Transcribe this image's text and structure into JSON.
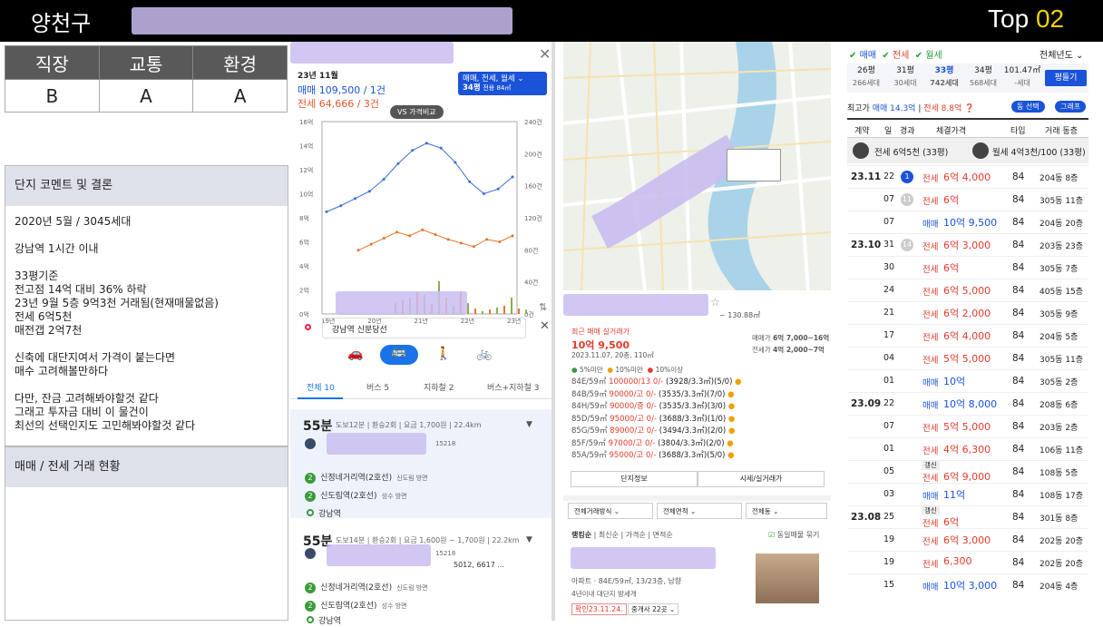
{
  "header": {
    "region": "양천구",
    "top_label": "Top",
    "top_number": "02"
  },
  "grades": {
    "headers": [
      "직장",
      "교통",
      "환경"
    ],
    "values": [
      "B",
      "A",
      "A"
    ]
  },
  "comment": {
    "title": "단지 코멘트 및 결론",
    "body": "2020년 5월 / 3045세대\n\n강남역 1시간 이내\n\n33평기준\n전고점 14억 대비 36% 하락\n23년 9월 5층 9억3천 거래됨(현재매물없음)\n전세 6억5천\n매전갭 2억7천\n\n신축에 대단지여서 가격이 붙는다면\n매수 고려해볼만하다\n\n다만, 잔금 고려해봐야할것 같다\n그래고 투자금 대비 이 물건이\n최선의 선택인지도 고민해봐야할것 같다"
  },
  "trade_status": {
    "title": "매매 / 전세 거래 현황"
  },
  "price_chart": {
    "date": "23년 11월",
    "sale": "매매 109,500 / 1건",
    "jeonse": "전세 64,666 / 3건",
    "filter": "매매, 전세, 월세",
    "size": "34평",
    "size_sub": "전용 84㎡",
    "compare_btn": "VS 가격비교"
  },
  "chart_data": {
    "type": "line",
    "x": [
      "19년",
      "20년",
      "21년",
      "22년",
      "23년"
    ],
    "y_left_ticks": [
      "16억",
      "14억",
      "12억",
      "10억",
      "8억",
      "6억",
      "4억",
      "2억",
      "0억"
    ],
    "y_right_ticks": [
      "240건",
      "200건",
      "160건",
      "120건",
      "80건",
      "40건",
      "0건"
    ],
    "series": [
      {
        "name": "매매",
        "values": [
          8.5,
          9.0,
          9.6,
          10.2,
          11.2,
          12.5,
          13.6,
          14.2,
          13.8,
          12.6,
          11.0,
          10.0,
          10.4,
          11.4
        ]
      },
      {
        "name": "전세",
        "values": [
          5.3,
          5.8,
          6.3,
          6.8,
          6.5,
          7.0,
          6.6,
          6.2,
          5.9,
          5.6,
          6.2,
          6.0,
          6.5
        ]
      }
    ],
    "volume": [
      20,
      25,
      30,
      40,
      35,
      18,
      60,
      30,
      15,
      40,
      20,
      10,
      5,
      8,
      12,
      15,
      30,
      10,
      8
    ]
  },
  "route": {
    "dest": "강남역 신분당선",
    "tabs": [
      "전체 10",
      "버스 5",
      "지하철 2",
      "버스+지하철 3"
    ],
    "r1": {
      "time": "55분",
      "detail": "도보12분 | 환승2회 | 요금 1,700원 | 22.4km",
      "code": "15218",
      "stops": [
        "신정네거리역(2호선)",
        "신도림역(2호선)",
        "강남역"
      ],
      "dirs": [
        "신도림 방면",
        "성수 방면"
      ]
    },
    "r2": {
      "time": "55분",
      "detail": "도보14분 | 환승2회 | 요금 1,600원 ~ 1,700원 | 22.2km",
      "code": "15218",
      "bus": "5012, 6617 ...",
      "stops": [
        "신정네거리역(2호선)",
        "신도림역(2호선)",
        "강남역"
      ],
      "dirs": [
        "신도림 방면",
        "성수 방면"
      ]
    }
  },
  "listing": {
    "area": "~ 130.88㎡",
    "recent_label": "최근 매매 실거래가",
    "recent_price": "10억 9,500",
    "recent_date": "2023.11.07, 20층, 110㎡",
    "sale_range_label": "매매가",
    "sale_range": "6억 7,000~16억",
    "jeonse_range_label": "전세가",
    "jeonse_range": "4억 2,000~7억",
    "legend": [
      "5%미만",
      "10%미만",
      "10%이상"
    ],
    "rows": [
      {
        "type": "84E/59㎡",
        "price": "100000/13 0/-",
        "info": "(3928/3.3㎡)(5/0)"
      },
      {
        "type": "84B/59㎡",
        "price": "90000/고 0/-",
        "info": "(3535/3.3㎡)(7/0)"
      },
      {
        "type": "84H/59㎡",
        "price": "90000/중 0/-",
        "info": "(3535/3.3㎡)(3/0)"
      },
      {
        "type": "85D/59㎡",
        "price": "95000/고 0/-",
        "info": "(3688/3.3㎡)(1/0)"
      },
      {
        "type": "85G/59㎡",
        "price": "89000/고 0/-",
        "info": "(3494/3.3㎡)(2/0)"
      },
      {
        "type": "85F/59㎡",
        "price": "97000/고 0/-",
        "info": "(3804/3.3㎡)(2/0)"
      },
      {
        "type": "85A/59㎡",
        "price": "95000/고 0/-",
        "info": "(3688/3.3㎡)(5/0)"
      }
    ],
    "btn1": "단지정보",
    "btn2": "시세/실거래가",
    "selects": [
      "전체거래방식",
      "전체면적",
      "전체동"
    ],
    "sorts": [
      "랭킹순",
      "최신순",
      "가격순",
      "면적순"
    ],
    "same_label": "동일매물 묶기",
    "item_desc": "아파트 · 84E/59㎡, 13/23층, 남향",
    "item_tags": "4년이내  대단지  방세개",
    "item_confirm": "확인23.11.24.",
    "item_agent": "중개사 22곳"
  },
  "right": {
    "filters": [
      "매매",
      "전세",
      "월세"
    ],
    "year": "전체년도",
    "sizes": [
      {
        "p": "26평",
        "u": "266세대"
      },
      {
        "p": "31평",
        "u": "30세대"
      },
      {
        "p": "33평",
        "u": "742세대"
      },
      {
        "p": "34평",
        "u": "568세대"
      },
      {
        "p": "101.47㎡",
        "u": "-세대"
      }
    ],
    "size_btn": "평들기",
    "recent": "최고가",
    "recent_sale": "매매 14.3억",
    "recent_jeonse": "전세 8.8억",
    "btn_dong": "동 선택",
    "btn_graph": "그래프",
    "cols": [
      "계약",
      "일",
      "경과",
      "체결가격",
      "타입",
      "거래 동층"
    ],
    "pinned": [
      {
        "label": "전세 6억5천 (33평)"
      },
      {
        "label": "월세 4억3천/100 (33평)"
      }
    ],
    "rows": [
      {
        "m": "23.11",
        "d": "22",
        "k": "1",
        "kind": "전세",
        "p": "6억 4,000",
        "t": "84",
        "f": "204동  8층"
      },
      {
        "m": "",
        "d": "07",
        "k": "11",
        "kind": "전세",
        "p": "6억",
        "t": "84",
        "f": "305동 11층"
      },
      {
        "m": "",
        "d": "07",
        "k": "",
        "kind": "매매",
        "p": "10억 9,500",
        "t": "84",
        "f": "204동 20층"
      },
      {
        "m": "23.10",
        "d": "31",
        "k": "14",
        "kind": "전세",
        "p": "6억 3,000",
        "t": "84",
        "f": "203동 23층"
      },
      {
        "m": "",
        "d": "30",
        "k": "",
        "kind": "전세",
        "p": "6억",
        "t": "84",
        "f": "305동  7층"
      },
      {
        "m": "",
        "d": "24",
        "k": "",
        "kind": "전세",
        "p": "6억 5,000",
        "t": "84",
        "f": "405동 15층"
      },
      {
        "m": "",
        "d": "21",
        "k": "",
        "kind": "전세",
        "p": "6억 2,000",
        "t": "84",
        "f": "305동  9층"
      },
      {
        "m": "",
        "d": "17",
        "k": "",
        "kind": "전세",
        "p": "6억 4,000",
        "t": "84",
        "f": "204동  5층"
      },
      {
        "m": "",
        "d": "04",
        "k": "",
        "kind": "전세",
        "p": "5억 5,000",
        "t": "84",
        "f": "305동 11층"
      },
      {
        "m": "",
        "d": "01",
        "k": "",
        "kind": "매매",
        "p": "10억",
        "t": "84",
        "f": "305동  2층"
      },
      {
        "m": "23.09",
        "d": "22",
        "k": "",
        "kind": "매매",
        "p": "10억 8,000",
        "t": "84",
        "f": "208동  6층"
      },
      {
        "m": "",
        "d": "07",
        "k": "",
        "kind": "전세",
        "p": "5억 5,000",
        "t": "84",
        "f": "203동  2층"
      },
      {
        "m": "",
        "d": "01",
        "k": "",
        "kind": "전세",
        "p": "4억 6,300",
        "t": "84",
        "f": "106동 11층"
      },
      {
        "m": "",
        "d": "05",
        "k": "",
        "kind": "전세",
        "p": "6억 9,000",
        "t": "84",
        "f": "108동  5층",
        "tag": "갱신"
      },
      {
        "m": "",
        "d": "03",
        "k": "",
        "kind": "매매",
        "p": "11억",
        "t": "84",
        "f": "108동 17층"
      },
      {
        "m": "23.08",
        "d": "25",
        "k": "",
        "kind": "전세",
        "p": "6억",
        "t": "84",
        "f": "301동  8층",
        "tag": "갱신"
      },
      {
        "m": "",
        "d": "19",
        "k": "",
        "kind": "전세",
        "p": "6억 3,000",
        "t": "84",
        "f": "202동 20층"
      },
      {
        "m": "",
        "d": "19",
        "k": "",
        "kind": "전세",
        "p": "6,300",
        "t": "84",
        "f": "202동 20층"
      },
      {
        "m": "",
        "d": "15",
        "k": "",
        "kind": "매매",
        "p": "10억 3,000",
        "t": "84",
        "f": "204동  4층"
      }
    ]
  }
}
